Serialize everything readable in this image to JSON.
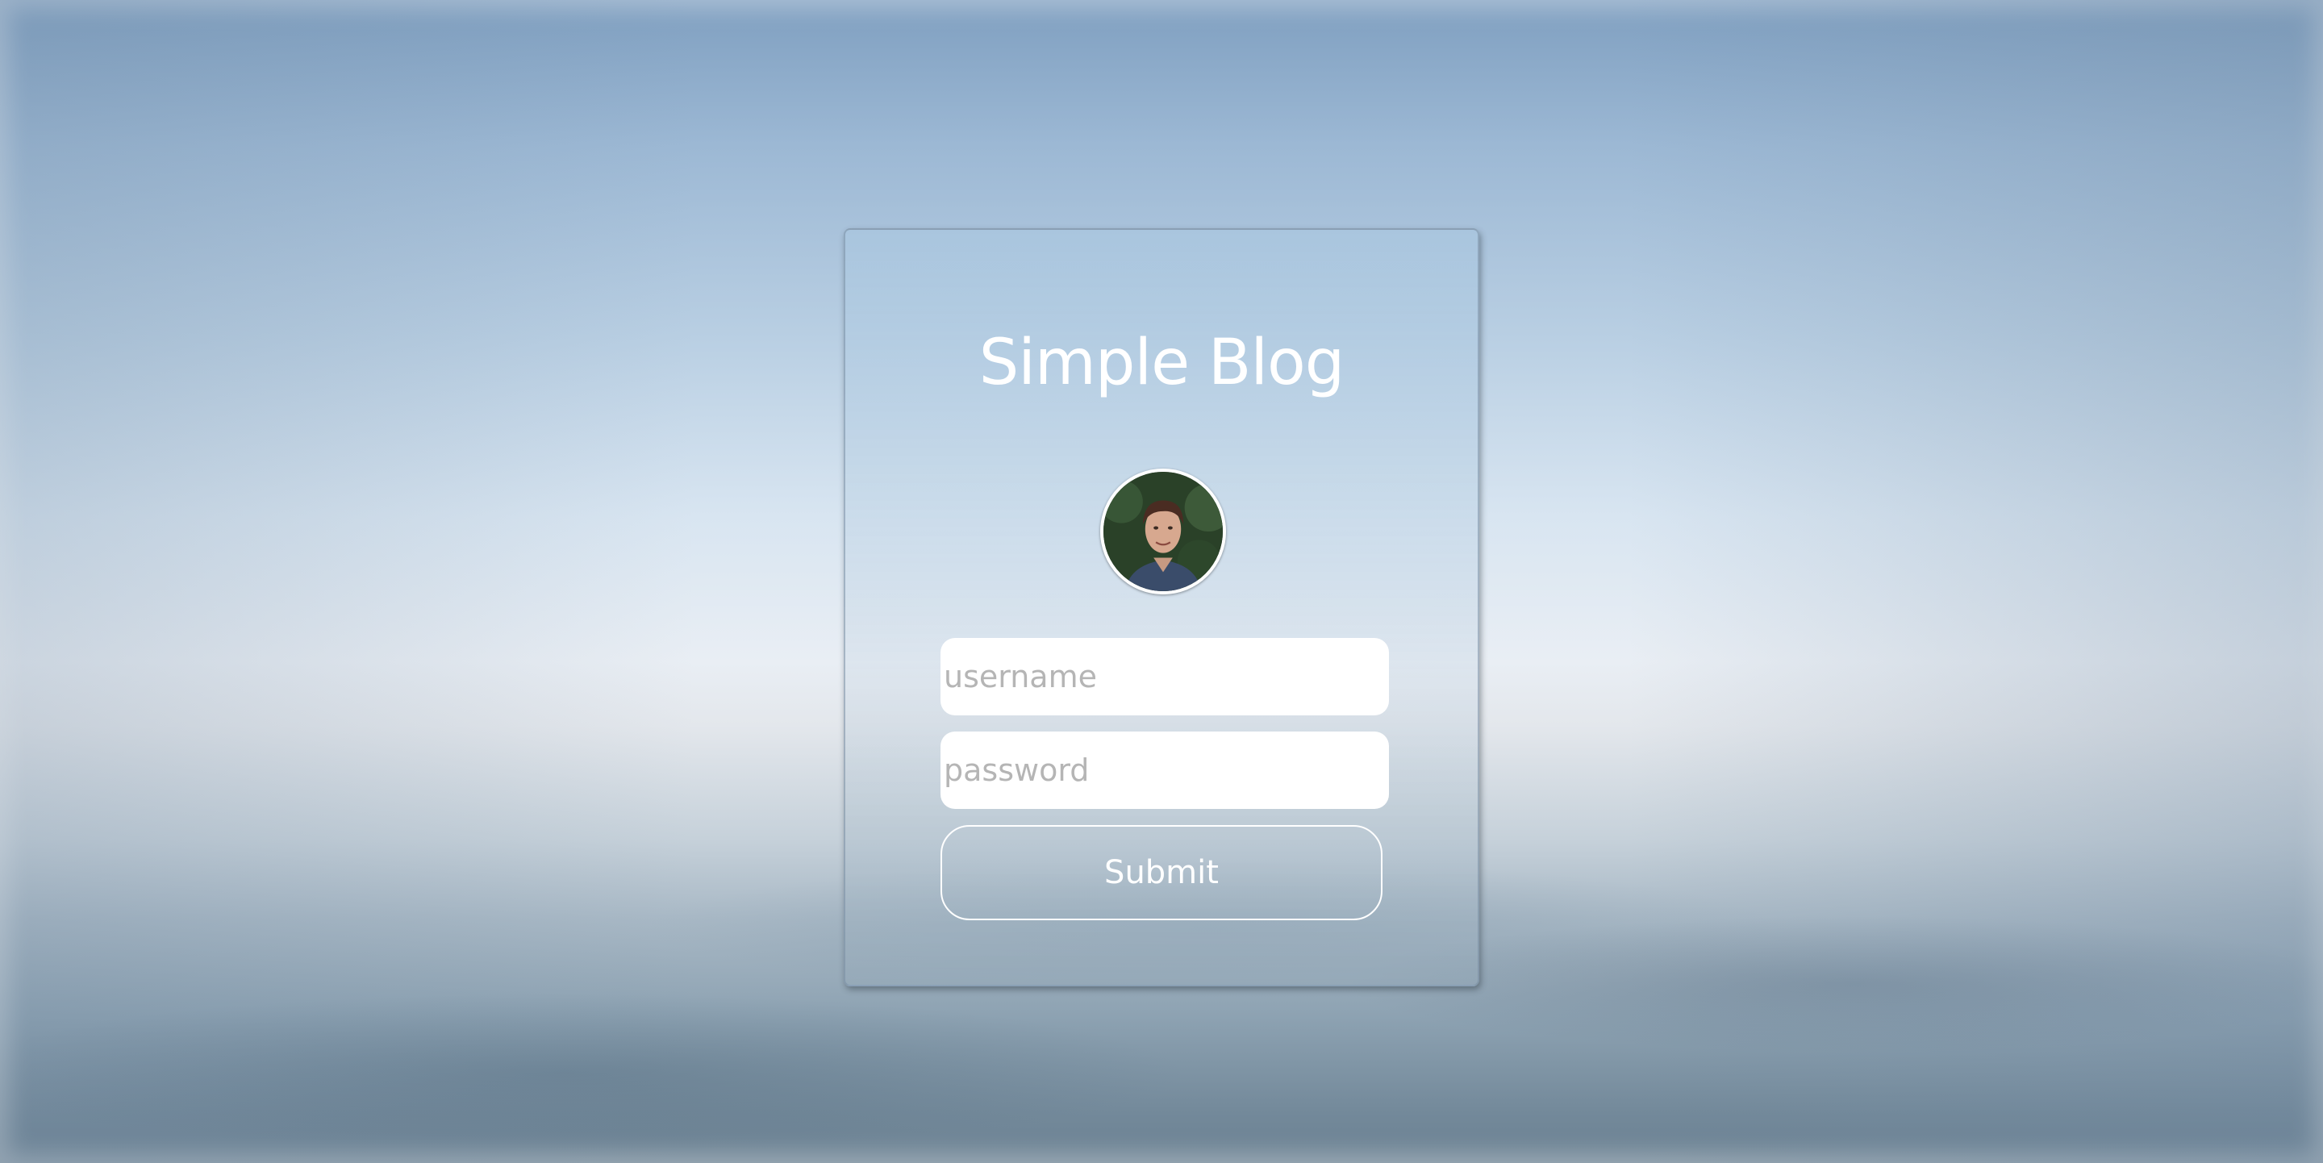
{
  "page": {
    "title": "Simple Blog"
  },
  "login_form": {
    "avatar_alt": "profile photo",
    "username": {
      "value": "",
      "placeholder": "username"
    },
    "password": {
      "value": "",
      "placeholder": "password"
    },
    "submit_label": "Submit"
  },
  "colors": {
    "card_border": "#ffffff",
    "title_text": "#ffffff",
    "placeholder_text": "#b5b5b5"
  }
}
